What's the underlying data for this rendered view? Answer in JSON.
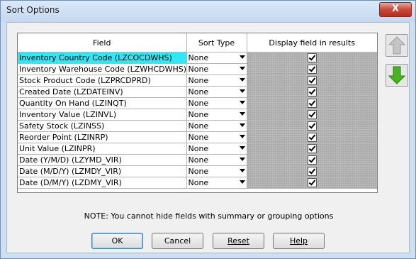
{
  "window": {
    "title": "Sort Options",
    "close_label": "X"
  },
  "table": {
    "headers": [
      "Field",
      "Sort Type",
      "Display field in results"
    ],
    "rows": [
      {
        "field": "Inventory Country Code (LZCOCDWHS)",
        "sort": "None",
        "display": true,
        "selected": true
      },
      {
        "field": "Inventory Warehouse Code (LZWHCDWHS)",
        "sort": "None",
        "display": true
      },
      {
        "field": "Stock Product Code (LZPRCDPRD)",
        "sort": "None",
        "display": true
      },
      {
        "field": "Created Date (LZDATEINV)",
        "sort": "None",
        "display": true
      },
      {
        "field": "Quantity On Hand (LZINQT)",
        "sort": "None",
        "display": true
      },
      {
        "field": "Inventory Value (LZINVL)",
        "sort": "None",
        "display": true
      },
      {
        "field": "Safety Stock (LZINSS)",
        "sort": "None",
        "display": true
      },
      {
        "field": "Reorder Point (LZINRP)",
        "sort": "None",
        "display": true
      },
      {
        "field": "Unit Value (LZINPR)",
        "sort": "None",
        "display": true
      },
      {
        "field": "Date (Y/M/D) (LZYMD_VIR)",
        "sort": "None",
        "display": true
      },
      {
        "field": "Date (M/D/Y) (LZMDY_VIR)",
        "sort": "None",
        "display": true
      },
      {
        "field": "Date (D/M/Y) (LZDMY_VIR)",
        "sort": "None",
        "display": true
      }
    ]
  },
  "side_buttons": {
    "up_icon": "arrow-up-icon",
    "down_icon": "arrow-down-icon",
    "up_color": "#b8b8b8",
    "down_color": "#3daa1e"
  },
  "note": "NOTE: You cannot hide fields with summary or grouping options",
  "buttons": {
    "ok": "OK",
    "cancel": "Cancel",
    "reset": "Reset",
    "help": "Help"
  }
}
